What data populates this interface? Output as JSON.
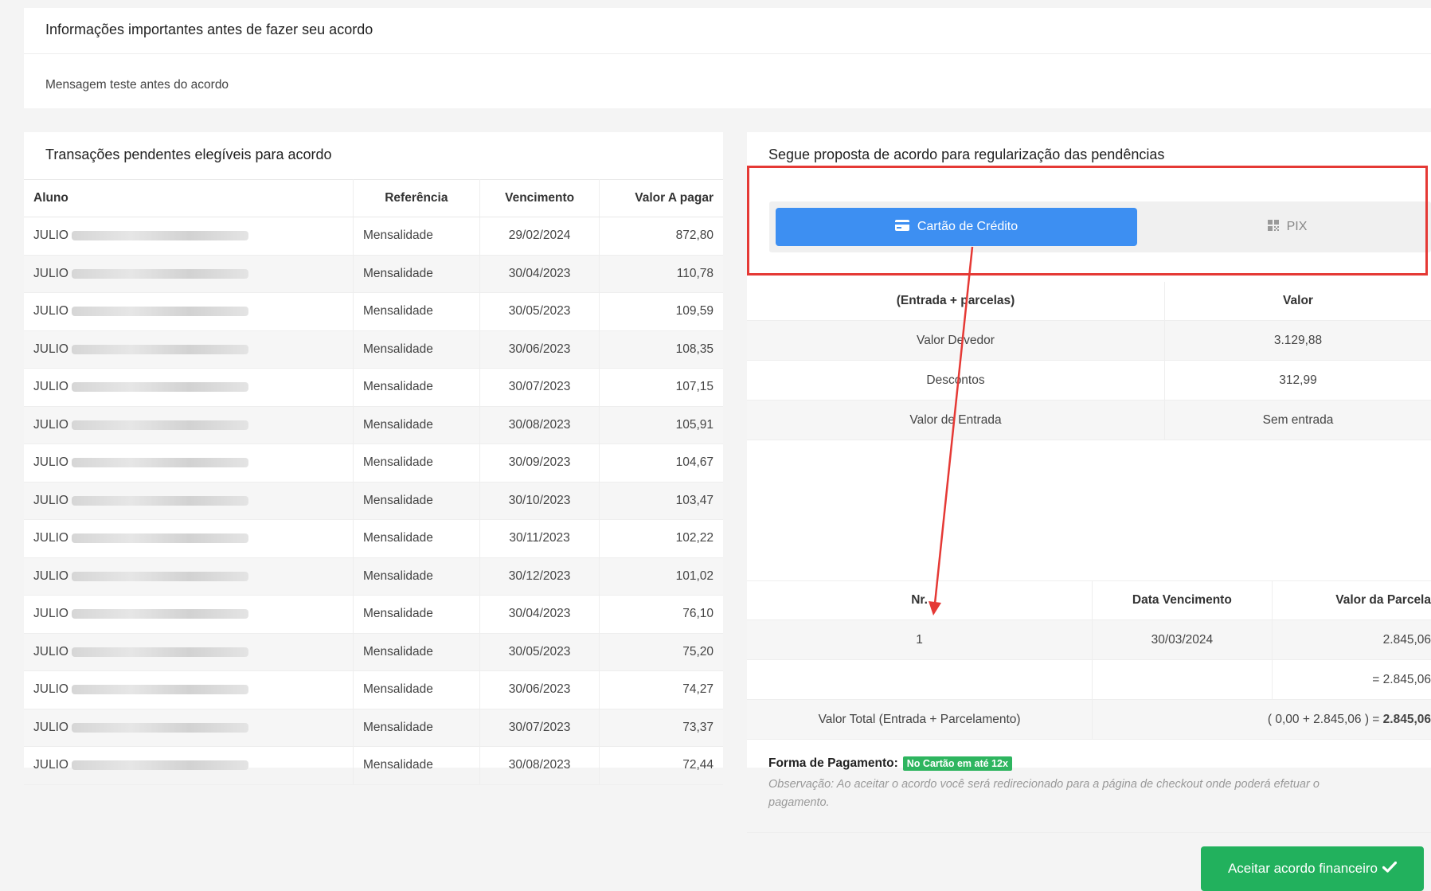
{
  "info": {
    "title": "Informações importantes antes de fazer seu acordo",
    "message": "Mensagem teste antes do acordo"
  },
  "transactions": {
    "title": "Transações pendentes elegíveis para acordo",
    "headers": {
      "aluno": "Aluno",
      "referencia": "Referência",
      "vencimento": "Vencimento",
      "valor": "Valor A pagar"
    },
    "rows": [
      {
        "aluno": "JULIO",
        "referencia": "Mensalidade",
        "vencimento": "29/02/2024",
        "valor": "872,80"
      },
      {
        "aluno": "JULIO",
        "referencia": "Mensalidade",
        "vencimento": "30/04/2023",
        "valor": "110,78"
      },
      {
        "aluno": "JULIO",
        "referencia": "Mensalidade",
        "vencimento": "30/05/2023",
        "valor": "109,59"
      },
      {
        "aluno": "JULIO",
        "referencia": "Mensalidade",
        "vencimento": "30/06/2023",
        "valor": "108,35"
      },
      {
        "aluno": "JULIO",
        "referencia": "Mensalidade",
        "vencimento": "30/07/2023",
        "valor": "107,15"
      },
      {
        "aluno": "JULIO",
        "referencia": "Mensalidade",
        "vencimento": "30/08/2023",
        "valor": "105,91"
      },
      {
        "aluno": "JULIO",
        "referencia": "Mensalidade",
        "vencimento": "30/09/2023",
        "valor": "104,67"
      },
      {
        "aluno": "JULIO",
        "referencia": "Mensalidade",
        "vencimento": "30/10/2023",
        "valor": "103,47"
      },
      {
        "aluno": "JULIO",
        "referencia": "Mensalidade",
        "vencimento": "30/11/2023",
        "valor": "102,22"
      },
      {
        "aluno": "JULIO",
        "referencia": "Mensalidade",
        "vencimento": "30/12/2023",
        "valor": "101,02"
      },
      {
        "aluno": "JULIO",
        "referencia": "Mensalidade",
        "vencimento": "30/04/2023",
        "valor": "76,10"
      },
      {
        "aluno": "JULIO",
        "referencia": "Mensalidade",
        "vencimento": "30/05/2023",
        "valor": "75,20"
      },
      {
        "aluno": "JULIO",
        "referencia": "Mensalidade",
        "vencimento": "30/06/2023",
        "valor": "74,27"
      },
      {
        "aluno": "JULIO",
        "referencia": "Mensalidade",
        "vencimento": "30/07/2023",
        "valor": "73,37"
      },
      {
        "aluno": "JULIO",
        "referencia": "Mensalidade",
        "vencimento": "30/08/2023",
        "valor": "72,44"
      }
    ]
  },
  "proposal": {
    "title": "Segue proposta de acordo para regularização das pendências",
    "tabs": [
      {
        "label": "Cartão de Crédito",
        "icon": "credit-card-icon",
        "active": true
      },
      {
        "label": "PIX",
        "icon": "pix-icon",
        "active": false
      }
    ],
    "summary_headers": {
      "left": "(Entrada + parcelas)",
      "right": "Valor"
    },
    "summary_rows": [
      {
        "label": "Valor Devedor",
        "value": "3.129,88"
      },
      {
        "label": "Descontos",
        "value": "312,99"
      },
      {
        "label": "Valor de Entrada",
        "value": "Sem entrada"
      }
    ],
    "installment_headers": {
      "nr": "Nr.",
      "data": "Data Vencimento",
      "valor": "Valor da Parcela"
    },
    "installments": [
      {
        "nr": "1",
        "data": "30/03/2024",
        "valor": "2.845,06"
      }
    ],
    "subtotal": "= 2.845,06",
    "total_label": "Valor Total (Entrada + Parcelamento)",
    "total_expression": "( 0,00 + 2.845,06 ) = ",
    "total_value": "2.845,06",
    "payment_label": "Forma de Pagamento:",
    "payment_badge": "No Cartão em até 12x",
    "observation": "Observação: Ao aceitar o acordo você será redirecionado para a página de checkout onde poderá efetuar o pagamento.",
    "accept_button": "Aceitar acordo financeiro"
  },
  "colors": {
    "tab_active": "#3d8ff2",
    "accept_button": "#22b15d",
    "badge": "#2eb55f",
    "annotation": "#e53935"
  }
}
